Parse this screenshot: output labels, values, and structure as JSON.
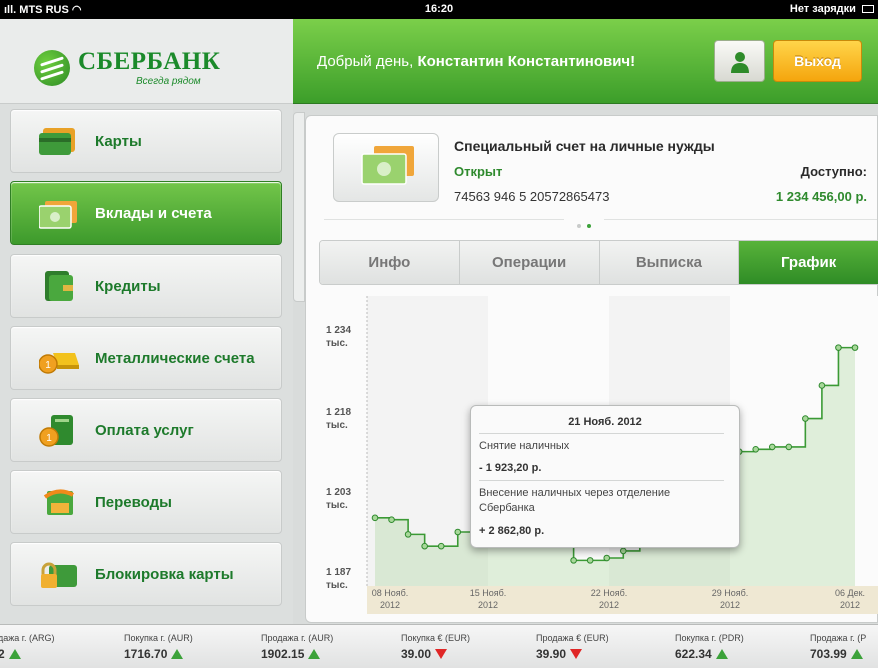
{
  "status_bar": {
    "carrier": "MTS RUS",
    "time": "16:20",
    "battery": "Нет зарядки"
  },
  "logo": {
    "name": "СБЕРБАНК",
    "slogan": "Всегда рядом"
  },
  "header": {
    "greeting_prefix": "Добрый день,",
    "user_name": "Константин Константинович!",
    "exit_label": "Выход"
  },
  "sidebar": {
    "items": [
      {
        "label": "Карты",
        "icon": "cards-icon"
      },
      {
        "label": "Вклады и счета",
        "icon": "deposits-icon"
      },
      {
        "label": "Кредиты",
        "icon": "credits-icon"
      },
      {
        "label": "Металлические счета",
        "icon": "metal-accounts-icon"
      },
      {
        "label": "Оплата услуг",
        "icon": "payments-icon"
      },
      {
        "label": "Переводы",
        "icon": "transfers-icon"
      },
      {
        "label": "Блокировка карты",
        "icon": "lock-card-icon"
      }
    ],
    "active_index": 1
  },
  "account": {
    "title": "Специальный счет на личные нужды",
    "status": "Открыт",
    "number": "74563 946 5 20572865473",
    "available_label": "Доступно:",
    "available_value": "1 234 456,00 р."
  },
  "tabs": [
    "Инфо",
    "Операции",
    "Выписка",
    "График"
  ],
  "active_tab": 3,
  "chart_data": {
    "type": "line",
    "y_ticks": [
      {
        "value": "1 234",
        "unit": "тыс."
      },
      {
        "value": "1 218",
        "unit": "тыс."
      },
      {
        "value": "1 203",
        "unit": "тыс."
      },
      {
        "value": "1 187",
        "unit": "тыс."
      }
    ],
    "x_ticks": [
      {
        "day": "08 Нояб.",
        "year": "2012"
      },
      {
        "day": "15 Нояб.",
        "year": "2012"
      },
      {
        "day": "22 Нояб.",
        "year": "2012"
      },
      {
        "day": "29 Нояб.",
        "year": "2012"
      },
      {
        "day": "06 Дек.",
        "year": "2012"
      }
    ],
    "series": [
      {
        "x": [
          0,
          1,
          2,
          3,
          4,
          5,
          6,
          7,
          8,
          9,
          10,
          11,
          12,
          13,
          14,
          15,
          16,
          17,
          18,
          19,
          20,
          21,
          22,
          23,
          24,
          25,
          26,
          27,
          28,
          29
        ],
        "y": [
          1199.0,
          1198.6,
          1195.5,
          1193.0,
          1193.0,
          1196.0,
          1197.0,
          1199.0,
          1204.0,
          1202.0,
          1201.0,
          1200.5,
          1190.0,
          1190.0,
          1190.5,
          1192.0,
          1195.0,
          1203.0,
          1205.0,
          1207.0,
          1209.0,
          1211.0,
          1213.0,
          1213.5,
          1214.0,
          1214.0,
          1220.0,
          1227.0,
          1235.0,
          1235.0
        ]
      }
    ],
    "grid": true
  },
  "tooltip": {
    "date": "21 Нояб. 2012",
    "op1_type": "Снятие наличных",
    "op1_amount": "- 1 923,20 р.",
    "op2_type": "Внесение наличных через отделение Сбербанка",
    "op2_amount": "+ 2 862,80 р."
  },
  "ticker": [
    {
      "label": "дажа г. (ARG)",
      "value": "2",
      "dir": "up"
    },
    {
      "label": "Покупка г. (AUR)",
      "value": "1716.70",
      "dir": "up"
    },
    {
      "label": "Продажа г. (AUR)",
      "value": "1902.15",
      "dir": "up"
    },
    {
      "label": "Покупка € (EUR)",
      "value": "39.00",
      "dir": "down"
    },
    {
      "label": "Продажа € (EUR)",
      "value": "39.90",
      "dir": "down"
    },
    {
      "label": "Покупка г. (PDR)",
      "value": "622.34",
      "dir": "up"
    },
    {
      "label": "Продажа г. (P",
      "value": "703.99",
      "dir": "up"
    }
  ],
  "colors": {
    "brand_green": "#3c9e2a",
    "accent_yellow": "#f5a50d",
    "down_red": "#e02626"
  }
}
